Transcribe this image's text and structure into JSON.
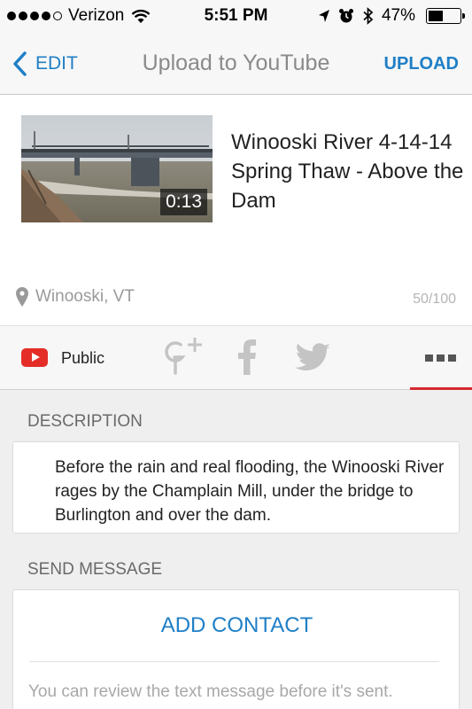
{
  "status_bar": {
    "carrier": "Verizon",
    "time": "5:51 PM",
    "battery_percent": "47%",
    "battery_level": 0.47,
    "signal_bars": 4,
    "icons": [
      "signal-dots-icon",
      "wifi-icon",
      "location-arrow-icon",
      "alarm-clock-icon",
      "bluetooth-icon",
      "battery-icon"
    ]
  },
  "nav": {
    "back_label": "EDIT",
    "title": "Upload to YouTube",
    "upload_label": "UPLOAD"
  },
  "video": {
    "title": "Winooski River 4-14-14 Spring Thaw - Above the Dam",
    "duration": "0:13",
    "location": "Winooski, VT",
    "char_count": "50/100"
  },
  "share": {
    "privacy_label": "Public",
    "icons": [
      "youtube-icon",
      "google-plus-icon",
      "facebook-icon",
      "twitter-icon",
      "more-icon"
    ]
  },
  "description": {
    "header": "DESCRIPTION",
    "text": "Before the rain and real flooding, the Winooski River rages by the Champlain Mill, under the bridge to Burlington and over the dam."
  },
  "send_message": {
    "header": "SEND MESSAGE",
    "add_contact_label": "ADD CONTACT",
    "note": "You can review the text message before it's sent."
  },
  "colors": {
    "accent": "#1f7fc6",
    "youtube_red": "#e52d27",
    "tab_underline": "#d5282f",
    "nav_background": "#f7f7f7",
    "content_background": "#efefef"
  }
}
